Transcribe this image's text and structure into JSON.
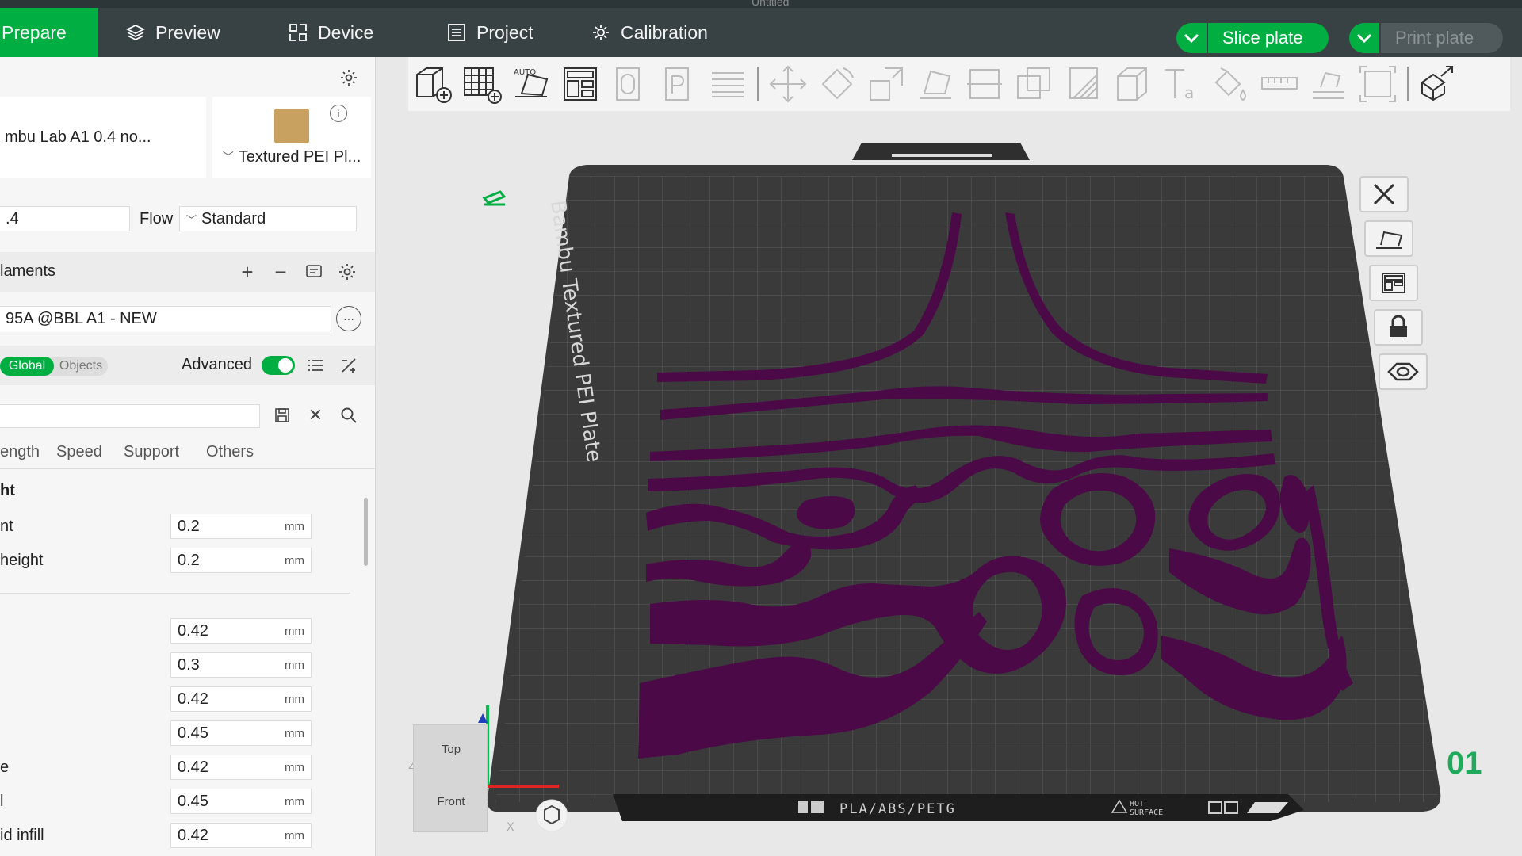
{
  "window": {
    "title": "Untitled"
  },
  "tabs": [
    {
      "label": "Prepare"
    },
    {
      "label": "Preview"
    },
    {
      "label": "Device"
    },
    {
      "label": "Project"
    },
    {
      "label": "Calibration"
    }
  ],
  "actions": {
    "slice_label": "Slice plate",
    "print_label": "Print plate"
  },
  "printer": {
    "name": "mbu Lab A1 0.4 no...",
    "plate": "Textured PEI Pl..."
  },
  "nozzle": {
    "value": ".4",
    "flow_label": "Flow",
    "flow_value": "Standard"
  },
  "filaments": {
    "header": "laments",
    "item": "95A @BBL A1 - NEW"
  },
  "settings_scope": {
    "global": "Global",
    "objects": "Objects",
    "advanced_label": "Advanced",
    "advanced_on": true
  },
  "settings_tabs": [
    "ength",
    "Speed",
    "Support",
    "Others"
  ],
  "section_title": "ht",
  "params": [
    {
      "label": "nt",
      "value": "0.2",
      "unit": "mm"
    },
    {
      "label": " height",
      "value": "0.2",
      "unit": "mm"
    },
    {
      "label": "",
      "value": "0.42",
      "unit": "mm"
    },
    {
      "label": "",
      "value": "0.3",
      "unit": "mm"
    },
    {
      "label": "",
      "value": "0.42",
      "unit": "mm"
    },
    {
      "label": "",
      "value": "0.45",
      "unit": "mm"
    },
    {
      "label": "e",
      "value": "0.42",
      "unit": "mm"
    },
    {
      "label": "l",
      "value": "0.45",
      "unit": "mm"
    },
    {
      "label": "id infill",
      "value": "0.42",
      "unit": "mm"
    }
  ],
  "plate": {
    "label": "Bambu Textured PEI Plate",
    "bottom_text": "PLA/ABS/PETG",
    "hot_line1": "HOT",
    "hot_line2": "SURFACE",
    "number": "01",
    "model_color": "#4b0a47",
    "bed_color": "#3a3a3a"
  },
  "navcube": {
    "top": "Top",
    "front": "Front"
  },
  "axes": {
    "x": "X",
    "z": "Z"
  },
  "colors": {
    "accent": "#00ae42",
    "topbar": "#384144"
  }
}
